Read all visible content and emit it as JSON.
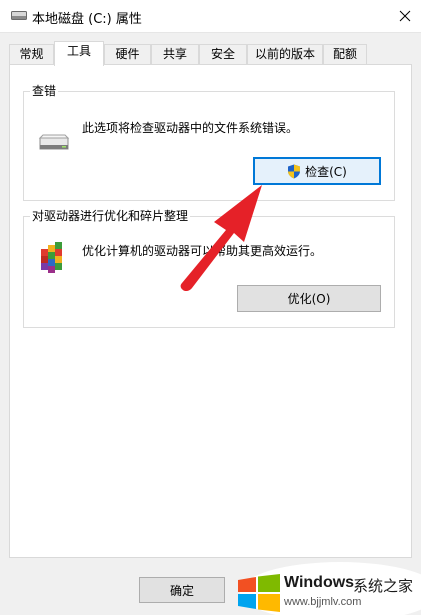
{
  "window": {
    "title": "本地磁盘 (C:) 属性",
    "close_icon": "close-icon"
  },
  "tabs": [
    {
      "label": "常规"
    },
    {
      "label": "工具",
      "active": true
    },
    {
      "label": "硬件"
    },
    {
      "label": "共享"
    },
    {
      "label": "安全"
    },
    {
      "label": "以前的版本"
    },
    {
      "label": "配额"
    }
  ],
  "check_group": {
    "title": "查错",
    "description": "此选项将检查驱动器中的文件系统错误。",
    "button_label": "检查(C)",
    "icon": "drive-icon",
    "button_icon": "uac-shield-icon"
  },
  "optimize_group": {
    "title": "对驱动器进行优化和碎片整理",
    "description": "优化计算机的驱动器可以帮助其更高效运行。",
    "button_label": "优化(O)",
    "icon": "defrag-icon"
  },
  "footer": {
    "ok_label": "确定"
  },
  "watermark": {
    "brand": "Windows",
    "suffix": "系统之家",
    "url": "www.bjjmlv.com"
  },
  "colors": {
    "accent": "#0078d7",
    "arrow": "#e52128"
  }
}
